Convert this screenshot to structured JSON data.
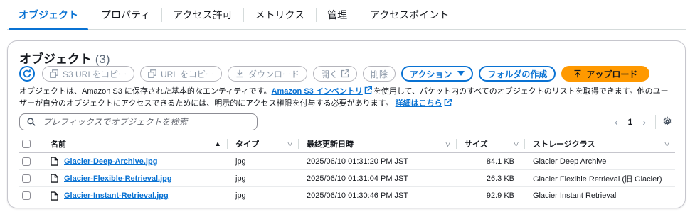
{
  "tabs": [
    "オブジェクト",
    "プロパティ",
    "アクセス許可",
    "メトリクス",
    "管理",
    "アクセスポイント"
  ],
  "panel": {
    "title": "オブジェクト",
    "count": "(3)"
  },
  "toolbar": {
    "copy_s3_uri": "S3 URI をコピー",
    "copy_url": "URL をコピー",
    "download": "ダウンロード",
    "open": "開く",
    "delete": "削除",
    "actions": "アクション",
    "create_folder": "フォルダの作成",
    "upload": "アップロード"
  },
  "description": {
    "part1": "オブジェクトは、Amazon S3 に保存された基本的なエンティティです。",
    "inventory_link": "Amazon S3 インベントリ",
    "part2": "を使用して、バケット内のすべてのオブジェクトのリストを取得できます。他のユーザーが自分のオブジェクトにアクセスできるためには、明示的にアクセス権限を付与する必要があります。",
    "details_link": "詳細はこちら"
  },
  "search": {
    "placeholder": "プレフィックスでオブジェクトを検索"
  },
  "pagination": {
    "page": "1"
  },
  "table": {
    "columns": [
      "名前",
      "タイプ",
      "最終更新日時",
      "サイズ",
      "ストレージクラス"
    ],
    "rows": [
      {
        "name": "Glacier-Deep-Archive.jpg",
        "type": "jpg",
        "modified": "2025/06/10 01:31:20 PM JST",
        "size": "84.1 KB",
        "storage_class": "Glacier Deep Archive"
      },
      {
        "name": "Glacier-Flexible-Retrieval.jpg",
        "type": "jpg",
        "modified": "2025/06/10 01:31:04 PM JST",
        "size": "26.3 KB",
        "storage_class": "Glacier Flexible Retrieval (旧 Glacier)"
      },
      {
        "name": "Glacier-Instant-Retrieval.jpg",
        "type": "jpg",
        "modified": "2025/06/10 01:30:46 PM JST",
        "size": "92.9 KB",
        "storage_class": "Glacier Instant Retrieval"
      }
    ]
  },
  "colors": {
    "accent": "#0972d3",
    "primary_button": "#ff9900",
    "disabled_text": "#8d99a8"
  }
}
